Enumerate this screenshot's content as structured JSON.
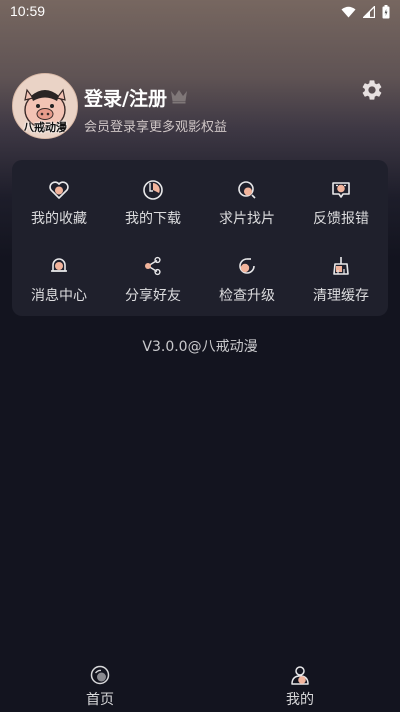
{
  "status_bar": {
    "time": "10:59",
    "icons": [
      "wifi-icon",
      "signal-icon",
      "battery-icon"
    ]
  },
  "profile": {
    "avatar_text": "八戒动漫",
    "login_title": "登录/注册",
    "login_subtitle": "会员登录享更多观影权益",
    "crown_icon": "crown-icon",
    "settings_icon": "gear-icon"
  },
  "menu": {
    "items": [
      {
        "label": "我的收藏",
        "icon": "heart-icon"
      },
      {
        "label": "我的下载",
        "icon": "download-icon"
      },
      {
        "label": "求片找片",
        "icon": "search-film-icon"
      },
      {
        "label": "反馈报错",
        "icon": "feedback-icon"
      },
      {
        "label": "消息中心",
        "icon": "bell-icon"
      },
      {
        "label": "分享好友",
        "icon": "share-icon"
      },
      {
        "label": "检查升级",
        "icon": "update-icon"
      },
      {
        "label": "清理缓存",
        "icon": "broom-icon"
      }
    ]
  },
  "version": "V3.0.0@八戒动漫",
  "bottom_nav": {
    "items": [
      {
        "label": "首页",
        "icon": "home-icon"
      },
      {
        "label": "我的",
        "icon": "profile-icon"
      }
    ]
  },
  "colors": {
    "accent": "#f2b49c",
    "background": "#13141f",
    "card": "#1f202c"
  }
}
